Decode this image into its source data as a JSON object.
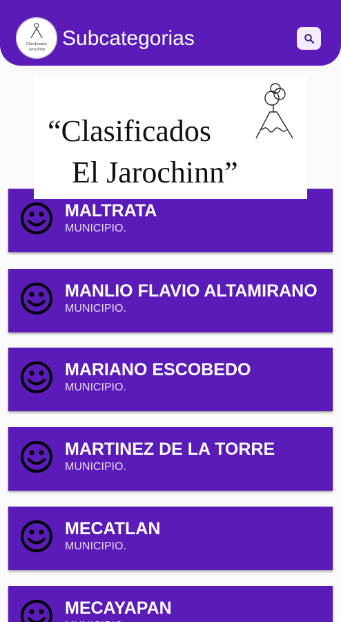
{
  "appbar": {
    "title": "Subcategorias",
    "logo_text_line1": "Clasificados",
    "logo_text_line2": "Jarochinn",
    "search_icon": "search-icon"
  },
  "banner": {
    "line1": "“Clasificados",
    "line2": "El Jarochinn”",
    "illustration": "volcano-icon"
  },
  "list": {
    "item_icon": "smiley-face-icon",
    "items": [
      {
        "name": "MALTRATA",
        "type": "MUNICIPIO."
      },
      {
        "name": "MANLIO FLAVIO ALTAMIRANO",
        "type": "MUNICIPIO."
      },
      {
        "name": "MARIANO ESCOBEDO",
        "type": "MUNICIPIO."
      },
      {
        "name": "MARTINEZ DE LA TORRE",
        "type": "MUNICIPIO."
      },
      {
        "name": "MECATLAN",
        "type": "MUNICIPIO."
      },
      {
        "name": "MECAYAPAN",
        "type": "MUNICIPIO."
      }
    ]
  },
  "colors": {
    "primary": "#5b1bb8",
    "card_text": "#ffffff",
    "subtitle_text": "#e6dcff",
    "search_bg": "#f3ecff"
  }
}
